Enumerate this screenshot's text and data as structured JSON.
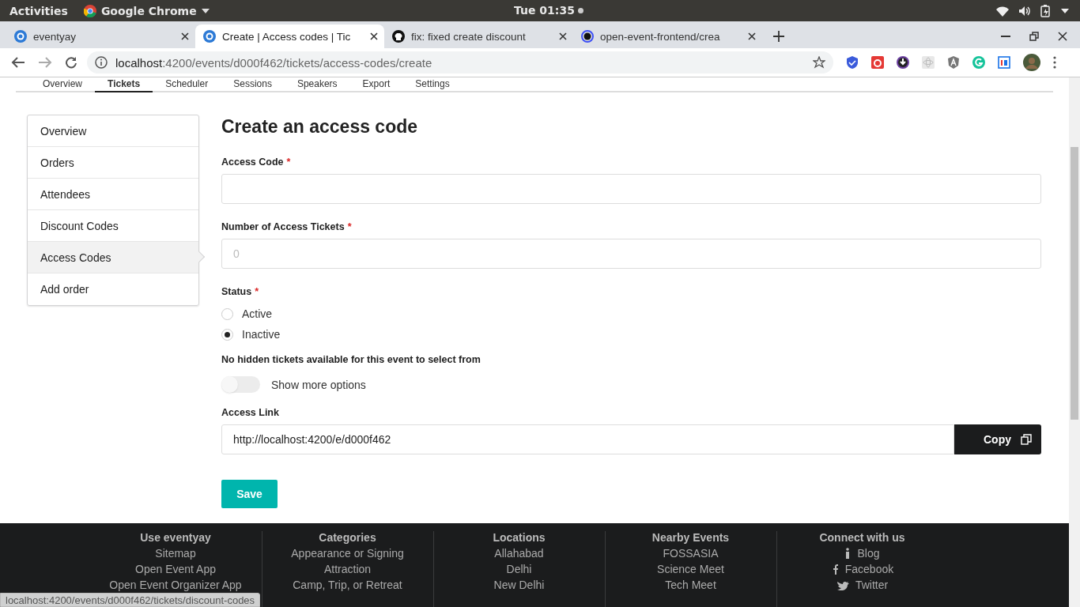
{
  "system_bar": {
    "activities": "Activities",
    "app": "Google Chrome",
    "clock": "Tue 01:35"
  },
  "browser": {
    "tabs": [
      {
        "title": "eventyay",
        "kind": "site",
        "selected": false
      },
      {
        "title": "Create | Access codes | Tic",
        "kind": "site",
        "selected": true
      },
      {
        "title": "fix: fixed create discount",
        "kind": "repo",
        "selected": false
      },
      {
        "title": "open-event-frontend/crea",
        "kind": "ring",
        "selected": false
      }
    ],
    "url": {
      "host": "localhost",
      "path": ":4200/events/d000f462/tickets/access-codes/create"
    }
  },
  "event_nav": [
    {
      "label": "Overview",
      "selected": false
    },
    {
      "label": "Tickets",
      "selected": true
    },
    {
      "label": "Scheduler",
      "selected": false
    },
    {
      "label": "Sessions",
      "selected": false
    },
    {
      "label": "Speakers",
      "selected": false
    },
    {
      "label": "Export",
      "selected": false
    },
    {
      "label": "Settings",
      "selected": false
    }
  ],
  "sidebar": [
    {
      "label": "Overview",
      "selected": false
    },
    {
      "label": "Orders",
      "selected": false
    },
    {
      "label": "Attendees",
      "selected": false
    },
    {
      "label": "Discount Codes",
      "selected": false
    },
    {
      "label": "Access Codes",
      "selected": true
    },
    {
      "label": "Add order",
      "selected": false
    }
  ],
  "form": {
    "title": "Create an access code",
    "access_code": {
      "label": "Access Code",
      "required_mark": "*"
    },
    "tickets_count": {
      "label": "Number of Access Tickets",
      "required_mark": "*",
      "placeholder": "0"
    },
    "status": {
      "label": "Status",
      "required_mark": "*",
      "options": [
        {
          "label": "Active",
          "selected": false
        },
        {
          "label": "Inactive",
          "selected": true
        }
      ]
    },
    "hidden_tickets_note": "No hidden tickets available for this event to select from",
    "more_options": {
      "label": "Show more options",
      "on": false
    },
    "access_link": {
      "label": "Access Link",
      "value": "http://localhost:4200/e/d000f462",
      "button": "Copy"
    },
    "save": "Save"
  },
  "footer": [
    {
      "title": "Use eventyay",
      "links": [
        {
          "label": "Sitemap"
        },
        {
          "label": "Open Event App"
        },
        {
          "label": "Open Event Organizer App"
        }
      ]
    },
    {
      "title": "Categories",
      "links": [
        {
          "label": "Appearance or Signing"
        },
        {
          "label": "Attraction"
        },
        {
          "label": "Camp, Trip, or Retreat"
        }
      ]
    },
    {
      "title": "Locations",
      "links": [
        {
          "label": "Allahabad"
        },
        {
          "label": "Delhi"
        },
        {
          "label": "New Delhi"
        }
      ]
    },
    {
      "title": "Nearby Events",
      "links": [
        {
          "label": "FOSSASIA"
        },
        {
          "label": "Science Meet"
        },
        {
          "label": "Tech Meet"
        }
      ]
    },
    {
      "title": "Connect with us",
      "links": [
        {
          "label": "Blog",
          "kind": "info"
        },
        {
          "label": "Facebook",
          "kind": "facebook"
        },
        {
          "label": "Twitter",
          "kind": "twitter"
        }
      ]
    }
  ],
  "status_url": "localhost:4200/events/d000f462/tickets/discount-codes"
}
